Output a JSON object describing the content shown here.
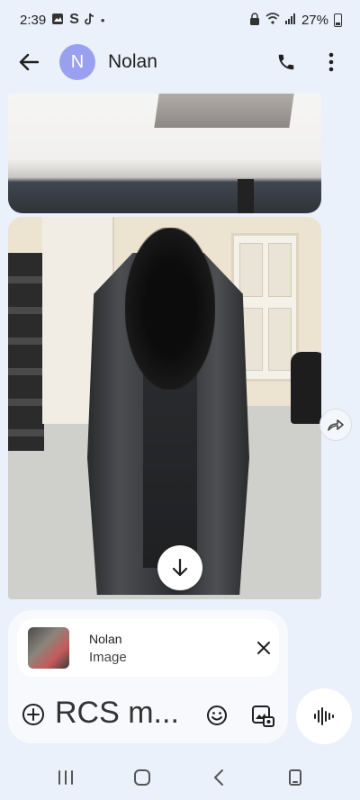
{
  "status_bar": {
    "time": "2:39",
    "battery": "27%",
    "icons": [
      "image-icon",
      "s-icon",
      "tiktok-icon",
      "dot-icon",
      "lock-icon",
      "wifi-icon",
      "signal-icon",
      "battery-icon"
    ]
  },
  "header": {
    "avatar_initial": "N",
    "contact_name": "Nolan",
    "icons": [
      "back-arrow-icon",
      "phone-icon",
      "more-vert-icon"
    ]
  },
  "conversation": {
    "images": [
      "image-message-top",
      "image-message-coat"
    ],
    "icons": [
      "scroll-down-arrow-icon",
      "forward-share-icon"
    ]
  },
  "compose": {
    "attachment": {
      "sender": "Nolan",
      "type_label": "Image"
    },
    "input_text": "RCS m...",
    "icons": [
      "add-circle-icon",
      "emoji-icon",
      "gallery-icon",
      "close-icon",
      "voice-wave-icon"
    ]
  },
  "nav_bar": {
    "icons": [
      "recents-icon",
      "home-icon",
      "back-icon",
      "screenshot-icon"
    ]
  },
  "colors": {
    "background": "#eaf1fb",
    "avatar": "#9aa0f0",
    "card": "#f7f9fc"
  }
}
